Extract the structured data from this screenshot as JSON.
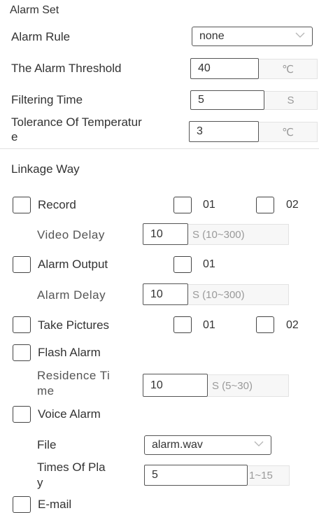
{
  "section_title": "Alarm Set",
  "alarm_rule": {
    "label": "Alarm Rule",
    "value": "none"
  },
  "alarm_threshold": {
    "label": "The Alarm Threshold",
    "value": "40",
    "unit": "℃"
  },
  "filtering_time": {
    "label": "Filtering Time",
    "value": "5",
    "unit": "S"
  },
  "tolerance": {
    "label_line1": "Tolerance Of Temperatur",
    "label_line2": "e",
    "value": "3",
    "unit": "℃"
  },
  "linkage": {
    "title": "Linkage Way",
    "record": {
      "label": "Record",
      "ch1": "01",
      "ch2": "02"
    },
    "video_delay": {
      "label": "Video Delay",
      "value": "10",
      "unit": "S (10~300)"
    },
    "alarm_output": {
      "label": "Alarm Output",
      "ch1": "01"
    },
    "alarm_delay": {
      "label": "Alarm Delay",
      "value": "10",
      "unit": "S (10~300)"
    },
    "take_pictures": {
      "label": "Take Pictures",
      "ch1": "01",
      "ch2": "02"
    },
    "flash_alarm": {
      "label": "Flash Alarm"
    },
    "residence_time": {
      "label_line1": "Residence Ti",
      "label_line2": "me",
      "value": "10",
      "unit": "S (5~30)"
    },
    "voice_alarm": {
      "label": "Voice Alarm"
    },
    "file": {
      "label": "File",
      "value": "alarm.wav"
    },
    "times_of_play": {
      "label_line1": "Times Of Pla",
      "label_line2": "y",
      "value": "5",
      "unit": "1~15"
    },
    "email": {
      "label": "E-mail"
    }
  },
  "icons": {
    "dropdown": "chevron-down-icon"
  }
}
